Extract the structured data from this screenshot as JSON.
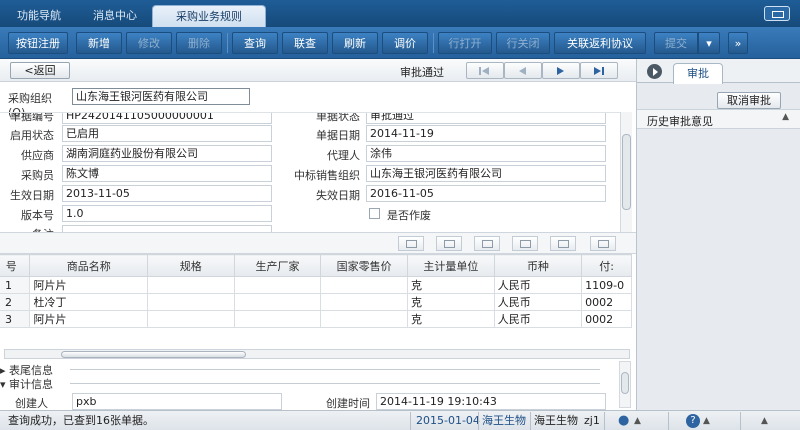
{
  "nav_tabs": [
    "功能导航",
    "消息中心",
    "采购业务规则"
  ],
  "toolbar": {
    "buttons": [
      "按钮注册",
      "新增",
      "修改",
      "删除",
      "查询",
      "联查",
      "刷新",
      "调价",
      "行打开",
      "行关闭",
      "关联返利协议",
      "提交"
    ],
    "more": "»"
  },
  "navbar": {
    "back": "返回",
    "status": "审批通过"
  },
  "org": {
    "label": "采购组织",
    "shortcut": "(O)",
    "value": "山东海王银河医药有限公司"
  },
  "form": {
    "left": [
      {
        "label": "单据编号",
        "value": "HP2420141105000000001"
      },
      {
        "label": "启用状态",
        "value": "已启用"
      },
      {
        "label": "供应商",
        "value": "湖南洞庭药业股份有限公司"
      },
      {
        "label": "采购员",
        "value": "陈文博"
      },
      {
        "label": "生效日期",
        "value": "2013-11-05"
      },
      {
        "label": "版本号",
        "value": "1.0"
      },
      {
        "label": "备注",
        "value": ""
      }
    ],
    "right": [
      {
        "label": "单据状态",
        "value": "审批通过"
      },
      {
        "label": "单据日期",
        "value": "2014-11-19"
      },
      {
        "label": "代理人",
        "value": "涂伟"
      },
      {
        "label": "中标销售组织",
        "value": "山东海王银河医药有限公司"
      },
      {
        "label": "失效日期",
        "value": "2016-11-05"
      }
    ],
    "checkbox": "是否作废"
  },
  "grid": {
    "columns": [
      "号",
      "商品名称",
      "规格",
      "生产厂家",
      "国家零售价",
      "主计量单位",
      "币种",
      "付:"
    ],
    "rows": [
      [
        "1",
        "阿片片",
        "",
        "",
        "",
        "克",
        "人民币",
        "1109-0"
      ],
      [
        "2",
        "杜冷丁",
        "",
        "",
        "",
        "克",
        "人民币",
        "0002"
      ],
      [
        "3",
        "阿片片",
        "",
        "",
        "",
        "克",
        "人民币",
        "0002"
      ]
    ]
  },
  "sections": {
    "tail": "表尾信息",
    "audit": "审计信息",
    "creator_label": "创建人",
    "creator": "pxb",
    "created_label": "创建时间",
    "created": "2014-11-19 19:10:43"
  },
  "right_panel": {
    "tab": "审批",
    "cancel": "取消审批",
    "history": "历史审批意见"
  },
  "statusbar": {
    "message": "查询成功，已查到16张单据。",
    "date": "2015-01-04",
    "org": "海王生物",
    "group": "海王生物",
    "user": "zj1"
  },
  "colors": {
    "toolbar": "#2a6aa8",
    "accent": "#1d4f86"
  }
}
